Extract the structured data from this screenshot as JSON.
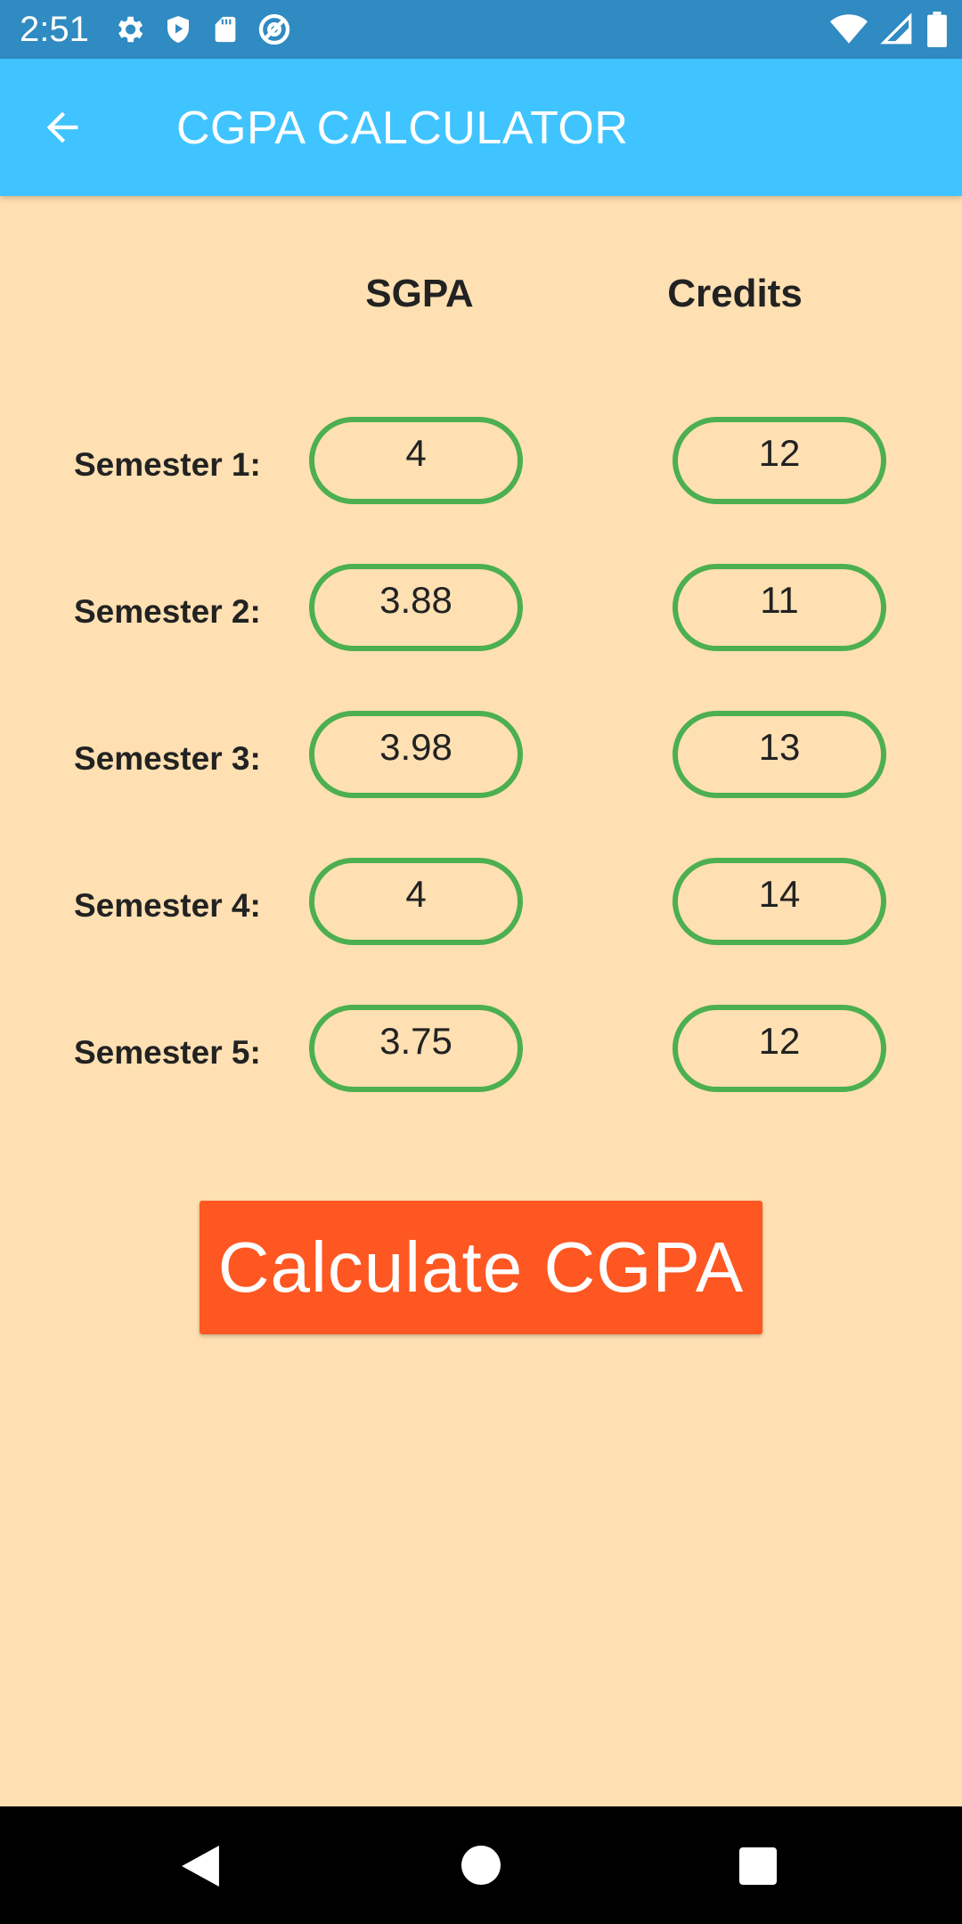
{
  "status_bar": {
    "time": "2:51",
    "left_icons": [
      "gear-icon",
      "shield-play-icon",
      "sd-card-icon",
      "at-sign-icon"
    ],
    "right_icons": [
      "wifi-icon",
      "cell-signal-icon",
      "battery-icon"
    ]
  },
  "app_bar": {
    "title": "CGPA CALCULATOR",
    "back_icon": "arrow-left-icon"
  },
  "columns": {
    "sgpa": "SGPA",
    "credits": "Credits"
  },
  "semesters": [
    {
      "label": "Semester 1:",
      "sgpa": "4",
      "credits": "12"
    },
    {
      "label": "Semester 2:",
      "sgpa": "3.88",
      "credits": "11"
    },
    {
      "label": "Semester 3:",
      "sgpa": "3.98",
      "credits": "13"
    },
    {
      "label": "Semester 4:",
      "sgpa": "4",
      "credits": "14"
    },
    {
      "label": "Semester 5:",
      "sgpa": "3.75",
      "credits": "12"
    }
  ],
  "calculate_button": "Calculate CGPA",
  "colors": {
    "status_bar": "#2F8BC1",
    "app_bar": "#40C4FF",
    "background": "#FFE0B2",
    "field_border": "#4CAF50",
    "button": "#FF5722"
  }
}
